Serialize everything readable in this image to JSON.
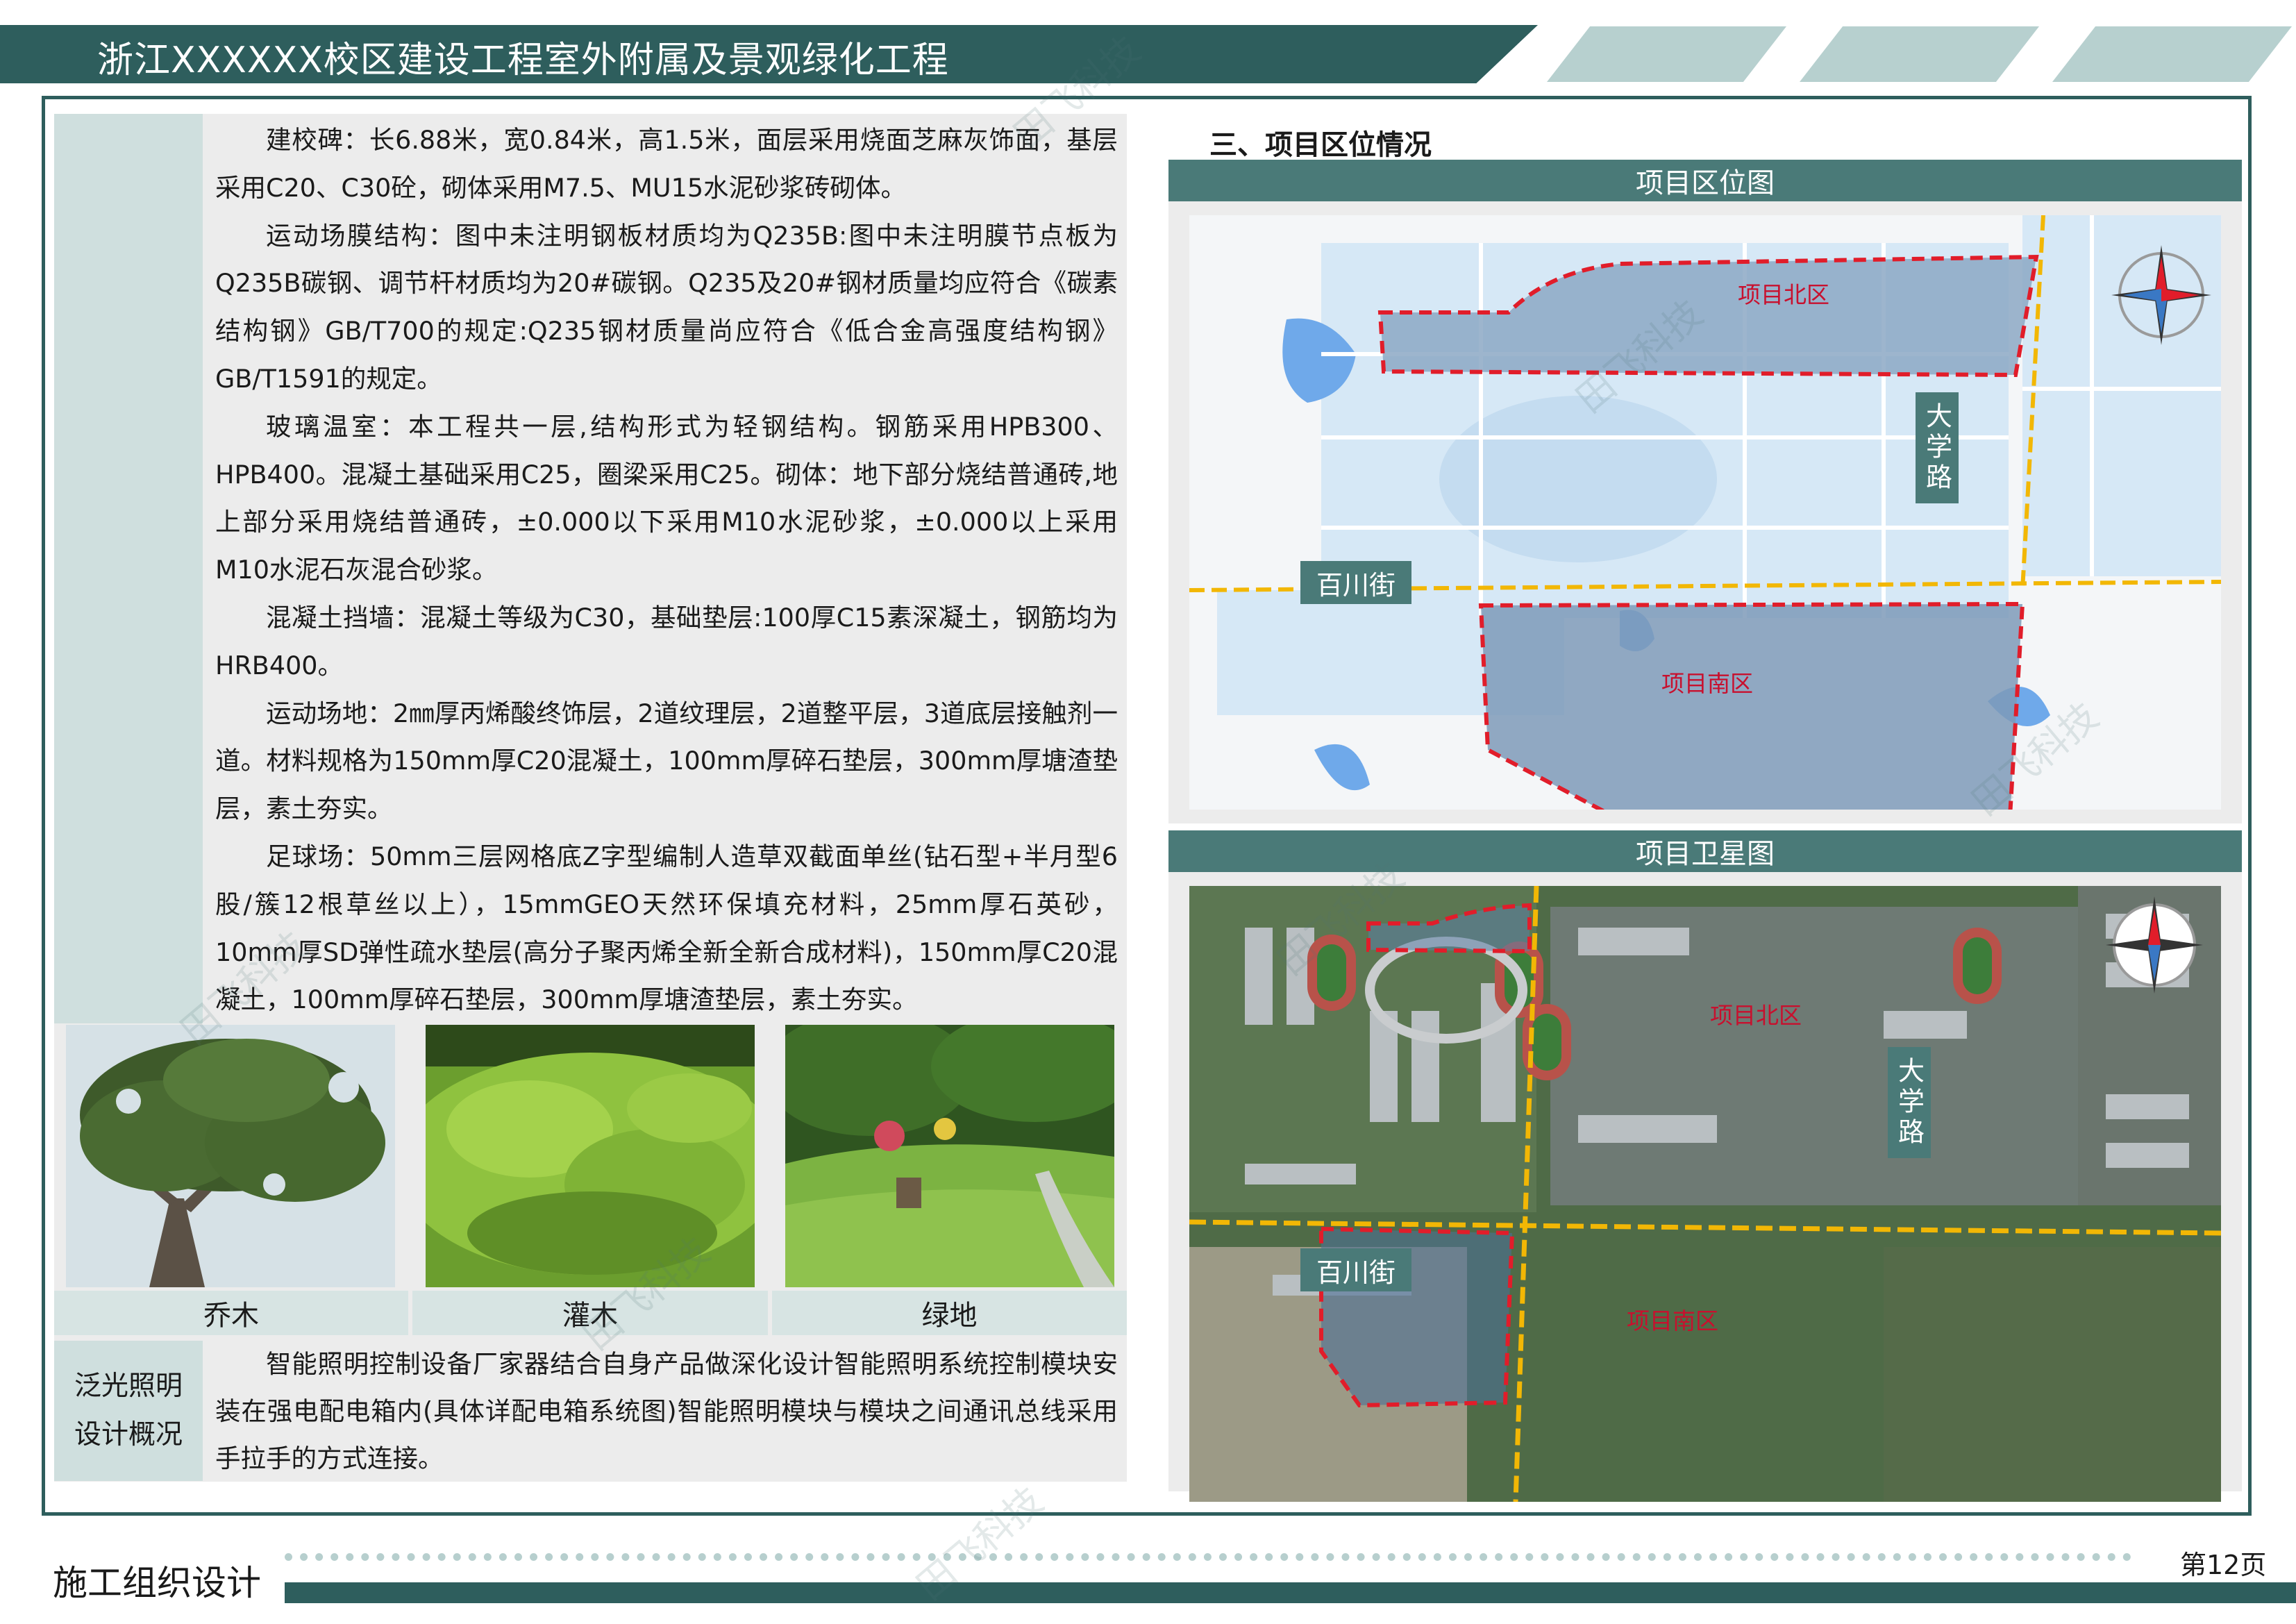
{
  "header": {
    "title": "浙江XXXXXX校区建设工程室外附属及景观绿化工程"
  },
  "left": {
    "paragraphs": [
      "建校碑：长6.88米，宽0.84米，高1.5米，面层采用烧面芝麻灰饰面，基层采用C20、C30砼，砌体采用M7.5、MU15水泥砂浆砖砌体。",
      "运动场膜结构：图中未注明钢板材质均为Q235B:图中未注明膜节点板为Q235B碳钢、调节杆材质均为20#碳钢。Q235及20#钢材质量均应符合《碳素结构钢》GB/T700的规定:Q235钢材质量尚应符合《低合金高强度结构钢》GB/T1591的规定。",
      "玻璃温室：本工程共一层,结构形式为轻钢结构。钢筋采用HPB300、HPB400。混凝土基础采用C25，圈梁采用C25。砌体：地下部分烧结普通砖,地上部分采用烧结普通砖，±0.000以下采用M10水泥砂浆，±0.000以上采用M10水泥石灰混合砂浆。",
      "混凝土挡墙：混凝土等级为C30，基础垫层:100厚C15素深凝土，钢筋均为HRB400。",
      "运动场地：2㎜厚丙烯酸终饰层，2道纹理层，2道整平层，3道底层接触剂一道。材料规格为150mm厚C20混凝土，100mm厚碎石垫层，300mm厚塘渣垫层，素土夯实。",
      "足球场：50mm三层网格底Z字型编制人造草双截面单丝(钻石型+半月型6股/簇12根草丝以上），15mmGEO天然环保填充材料，25mm厚石英砂，10mm厚SD弹性疏水垫层(高分子聚丙烯全新全新合成材料)，150mm厚C20混凝土，100mm厚碎石垫层，300mm厚塘渣垫层，素土夯实。"
    ],
    "captions": [
      "乔木",
      "灌木",
      "绿地"
    ],
    "lighting": {
      "label_line1": "泛光照明",
      "label_line2": "设计概况",
      "text": "智能照明控制设备厂家器结合自身产品做深化设计智能照明系统控制模块安装在强电配电箱内(具体详配电箱系统图)智能照明模块与模块之间通讯总线采用手拉手的方式连接。"
    }
  },
  "right": {
    "section_title": "三、项目区位情况",
    "map1": {
      "title": "项目区位图",
      "north_zone": "项目北区",
      "south_zone": "项目南区",
      "road_avenue": "大学路",
      "road_street": "百川街"
    },
    "map2": {
      "title": "项目卫星图",
      "north_zone": "项目北区",
      "south_zone": "项目南区",
      "road_avenue": "大学路",
      "road_street": "百川街"
    }
  },
  "footer": {
    "title": "施工组织设计",
    "page": "第12页"
  },
  "watermark": "田飞科技",
  "colors": {
    "primary": "#2e5e5d",
    "accent_light": "#b7d0cf",
    "panel_bg": "#ececec",
    "label_bg": "#cfdfde",
    "zone_outline": "#e11d2a",
    "road_yellow": "#f2b705"
  }
}
